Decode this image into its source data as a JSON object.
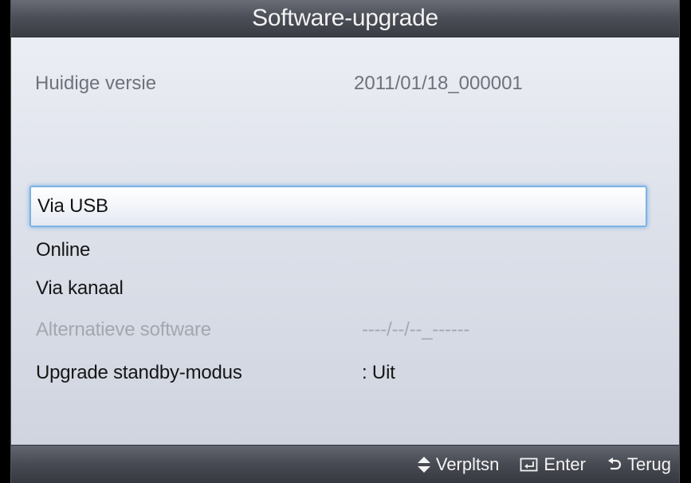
{
  "window": {
    "title": "Software-upgrade"
  },
  "version": {
    "label": "Huidige versie",
    "value": "2011/01/18_000001"
  },
  "menu": {
    "items": [
      {
        "label": "Via USB",
        "value": "",
        "state": "selected"
      },
      {
        "label": "Online",
        "value": "",
        "state": "normal"
      },
      {
        "label": "Via kanaal",
        "value": "",
        "state": "normal"
      },
      {
        "label": "Alternatieve software",
        "value": "----/--/--_------",
        "state": "disabled"
      },
      {
        "label": "Upgrade standby-modus",
        "value": ": Uit",
        "state": "normal"
      }
    ]
  },
  "footer": {
    "hints": [
      {
        "icon": "up-down-arrows-icon",
        "label": "Verpltsn"
      },
      {
        "icon": "enter-icon",
        "label": "Enter"
      },
      {
        "icon": "return-icon",
        "label": "Terug"
      }
    ]
  },
  "colors": {
    "highlight": "#7db3e4",
    "panel": "#dde1ea",
    "bar": "#4a4d55"
  }
}
